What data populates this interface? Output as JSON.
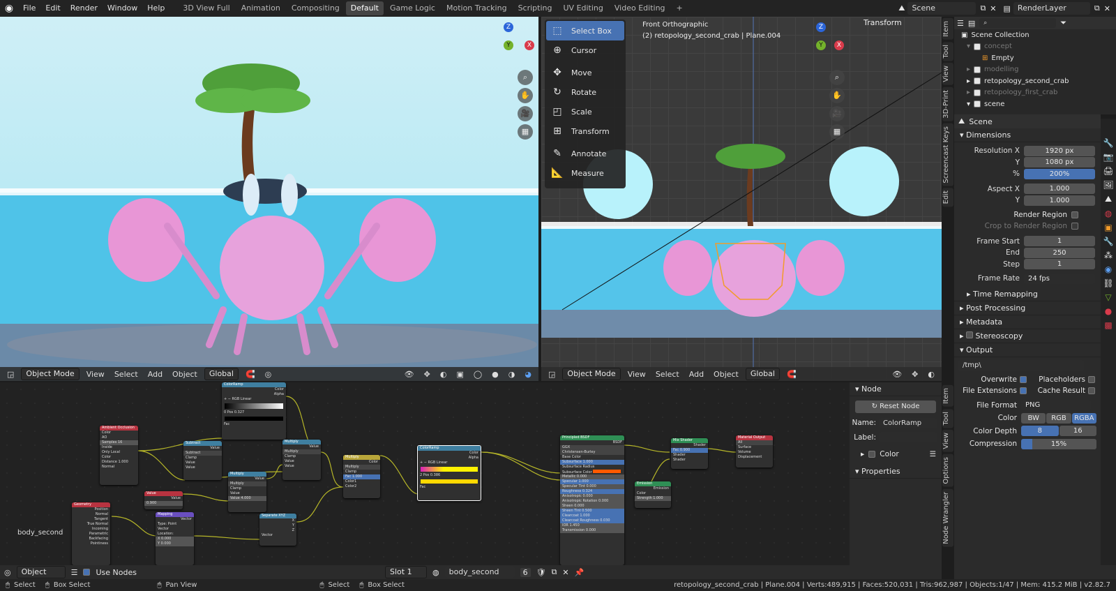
{
  "menu": [
    "File",
    "Edit",
    "Render",
    "Window",
    "Help"
  ],
  "workspaces": [
    "3D View Full",
    "Animation",
    "Compositing",
    "Default",
    "Game Logic",
    "Motion Tracking",
    "Scripting",
    "UV Editing",
    "Video Editing"
  ],
  "active_workspace": "Default",
  "scene_name": "Scene",
  "render_layer": "RenderLayer",
  "left_vp": {
    "mode": "Object Mode",
    "menus": [
      "View",
      "Select",
      "Add",
      "Object"
    ],
    "orientation": "Global"
  },
  "right_vp": {
    "title": "Front Orthographic",
    "subtitle": "(2) retopology_second_crab | Plane.004",
    "mode": "Object Mode",
    "menus": [
      "View",
      "Select",
      "Add",
      "Object"
    ],
    "orientation": "Global",
    "transform_panel": "Transform"
  },
  "tools": [
    "Select Box",
    "Cursor",
    "Move",
    "Rotate",
    "Scale",
    "Transform",
    "Annotate",
    "Measure"
  ],
  "right_tabs": [
    "Item",
    "Tool",
    "View",
    "3D-Print",
    "Screencast Keys",
    "Edit"
  ],
  "outliner": {
    "root": "Scene Collection",
    "items": [
      {
        "name": "concept",
        "dim": true
      },
      {
        "name": "Empty",
        "dim": false
      },
      {
        "name": "modelling",
        "dim": true
      },
      {
        "name": "retopology_second_crab",
        "dim": false
      },
      {
        "name": "retopology_first_crab",
        "dim": true
      },
      {
        "name": "scene",
        "dim": false
      }
    ]
  },
  "props": {
    "context": "Scene",
    "dimensions": "Dimensions",
    "rows": [
      [
        "Resolution X",
        "1920 px"
      ],
      [
        "Y",
        "1080 px"
      ],
      [
        "%",
        "200%"
      ],
      [
        "Aspect X",
        "1.000"
      ],
      [
        "Y",
        "1.000"
      ]
    ],
    "render_region": "Render Region",
    "crop": "Crop to Render Region",
    "frames": [
      [
        "Frame Start",
        "1"
      ],
      [
        "End",
        "250"
      ],
      [
        "Step",
        "1"
      ]
    ],
    "frame_rate_label": "Frame Rate",
    "frame_rate": "24 fps",
    "sections": [
      "Time Remapping",
      "Post Processing",
      "Metadata",
      "Stereoscopy",
      "Output"
    ],
    "output_path": "/tmp\\",
    "overwrite": "Overwrite",
    "placeholders": "Placeholders",
    "file_ext": "File Extensions",
    "cache": "Cache Result",
    "file_format_label": "File Format",
    "file_format": "PNG",
    "color_label": "Color",
    "color_opts": [
      "BW",
      "RGB",
      "RGBA"
    ],
    "depth_label": "Color Depth",
    "depth_opts": [
      "8",
      "16"
    ],
    "compression_label": "Compression",
    "compression": "15%"
  },
  "node_panel": {
    "title": "Node",
    "reset": "Reset Node",
    "name_label": "Name:",
    "name": "ColorRamp",
    "label_label": "Label:",
    "color": "Color",
    "properties": "Properties"
  },
  "node_tabs": [
    "Item",
    "Tool",
    "View",
    "Options",
    "Node Wrangler"
  ],
  "nodes": [
    {
      "title": "Ambient Occlusion",
      "color": "#b83340"
    },
    {
      "title": "ColorRamp",
      "color": "#3f7fa0"
    },
    {
      "title": "Subtract",
      "color": "#3f7fa0"
    },
    {
      "title": "Multiply",
      "color": "#3f7fa0"
    },
    {
      "title": "Multiply",
      "color": "#3f7fa0"
    },
    {
      "title": "Value",
      "color": "#b83340"
    },
    {
      "title": "Multiply",
      "color": "#b9a63a"
    },
    {
      "title": "ColorRamp",
      "color": "#3f7fa0"
    },
    {
      "title": "Geometry",
      "color": "#b83340"
    },
    {
      "title": "Mapping",
      "color": "#6a4fbf"
    },
    {
      "title": "Separate XYZ",
      "color": "#3f7fa0"
    },
    {
      "title": "Principled BSDF",
      "color": "#2f8f55"
    },
    {
      "title": "Emission",
      "color": "#2f8f55"
    },
    {
      "title": "Mix Shader",
      "color": "#2f8f55"
    },
    {
      "title": "Material Output",
      "color": "#b83340"
    }
  ],
  "material_label": "body_second",
  "footer": {
    "mode": "Object",
    "use_nodes": "Use Nodes",
    "slot": "Slot 1",
    "material": "body_second",
    "users": "6"
  },
  "status": {
    "left": [
      [
        "Select",
        "Box Select"
      ],
      [
        "Pan View"
      ],
      [
        "Select",
        "Box Select"
      ]
    ],
    "right": "retopology_second_crab | Plane.004 | Verts:489,915 | Faces:520,031 | Tris:962,987 | Objects:1/47 | Mem: 415.2 MiB | v2.82.7"
  }
}
